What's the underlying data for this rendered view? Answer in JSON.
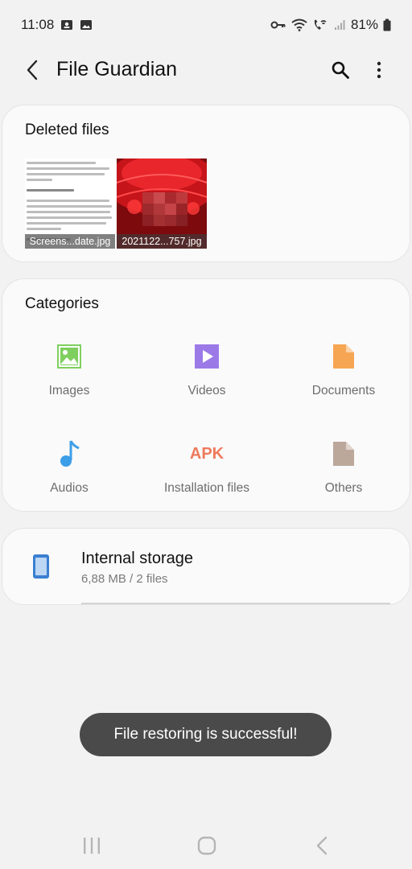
{
  "status_bar": {
    "time": "11:08",
    "battery": "81%",
    "icons": [
      "contact-card-icon",
      "image-icon",
      "vpn-key-icon",
      "wifi-icon",
      "wifi-call-icon",
      "signal-icon",
      "battery-icon"
    ]
  },
  "app_bar": {
    "title": "File Guardian",
    "icons": [
      "back-arrow-icon",
      "search-icon",
      "more-vert-icon"
    ]
  },
  "deleted_files": {
    "title": "Deleted files",
    "items": [
      {
        "caption": "Screens...date.jpg"
      },
      {
        "caption": "2021122...757.jpg"
      }
    ]
  },
  "categories": {
    "title": "Categories",
    "items": [
      {
        "label": "Images",
        "icon": "image-icon",
        "color": "#7fcf5f"
      },
      {
        "label": "Videos",
        "icon": "video-icon",
        "color": "#9b7ae8"
      },
      {
        "label": "Documents",
        "icon": "document-icon",
        "color": "#f6a552"
      },
      {
        "label": "Audios",
        "icon": "music-note-icon",
        "color": "#3d9ee8"
      },
      {
        "label": "Installation files",
        "icon": "apk-icon",
        "icon_text": "APK",
        "color": "#ee7a5c"
      },
      {
        "label": "Others",
        "icon": "file-icon",
        "color": "#bca79b"
      }
    ]
  },
  "storage": {
    "title": "Internal storage",
    "subtitle": "6,88 MB / 2 files",
    "icon": "phone-icon",
    "color": "#3b7fd1"
  },
  "toast": {
    "text": "File restoring is successful!"
  },
  "nav_bar": {
    "icons": [
      "recent-apps-icon",
      "home-icon",
      "back-icon"
    ]
  }
}
